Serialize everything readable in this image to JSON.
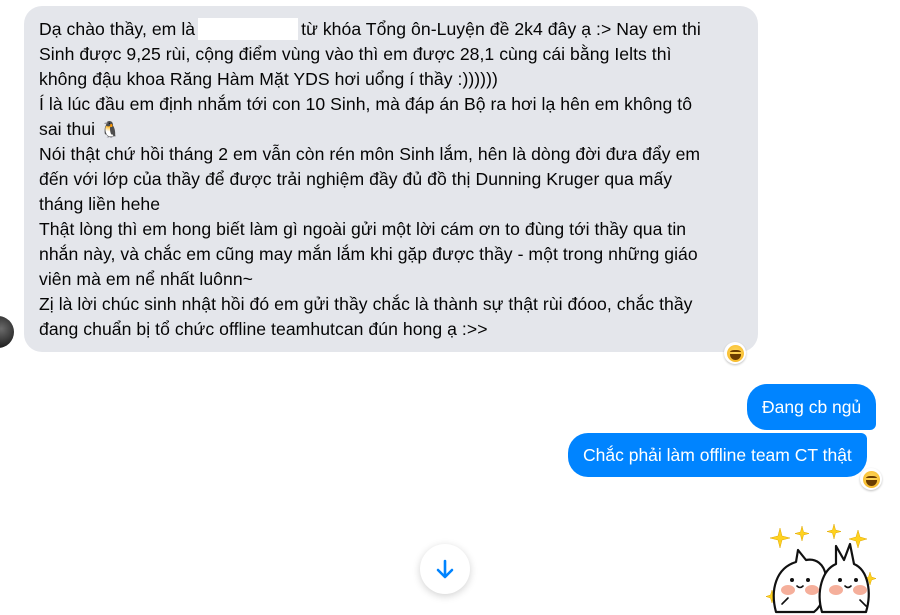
{
  "incoming_message": {
    "lines": [
      {
        "before": "Dạ chào thầy, em là",
        "after": "từ khóa Tổng ôn-Luyện đề 2k4 đây ạ :> Nay em thi"
      },
      "Sinh được 9,25 rùi, cộng điểm vùng vào thì em được 28,1 cùng cái bằng Ielts thì",
      "không đậu khoa Răng Hàm Mặt YDS hơi uổng í thầy :))))))",
      "Í là lúc đầu em định nhắm tới con 10 Sinh, mà đáp án Bộ ra hơi lạ hên em không tô",
      "sai thui",
      "Nói thật chứ hồi tháng 2 em vẫn còn rén môn Sinh lắm, hên là dòng đời đưa đẩy em",
      "đến với lớp của thầy để được trải nghiệm đầy đủ đồ thị Dunning Kruger qua mấy",
      "tháng liền hehe",
      "Thật lòng thì em hong biết làm gì ngoài gửi một lời cám ơn to đùng tới thầy qua tin",
      "nhắn này, và chắc em cũng may mắn lắm khi gặp được thầy - một trong những giáo",
      "viên mà em nể nhất luônn~",
      "Zị là lời chúc sinh nhật hồi đó em gửi thầy chắc là thành sự thật rùi đóoo, chắc thầy",
      "đang chuẩn bị tổ chức offline teamhutcan đún hong ạ :>>"
    ],
    "emoji": "🐧",
    "reaction": "laughing-face"
  },
  "outgoing_messages": [
    {
      "text": "Đang cb ngủ"
    },
    {
      "text": "Chắc phải làm offline team CT thật",
      "reaction": "laughing-face"
    }
  ],
  "icons": {
    "scroll_down": "arrow-down-icon",
    "sticker": "two-cats-sparkle-sticker"
  },
  "colors": {
    "incoming_bubble": "#e4e6eb",
    "outgoing_bubble": "#0084ff",
    "accent": "#0084ff"
  }
}
